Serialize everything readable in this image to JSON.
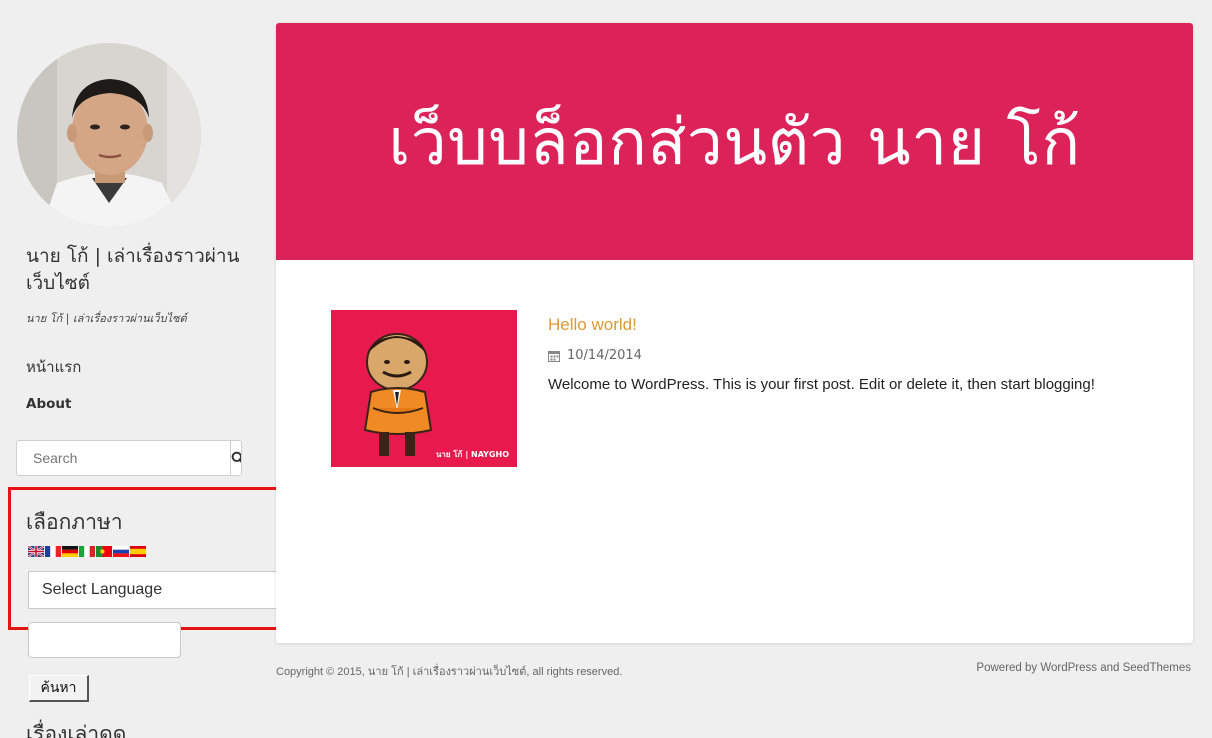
{
  "sidebar": {
    "site_title": "นาย โก้ | เล่าเรื่องราวผ่านเว็บไซต์",
    "site_tagline": "นาย โก้ | เล่าเรื่องราวผ่านเว็บไซต์",
    "nav": [
      {
        "label": "หน้าแรก"
      },
      {
        "label": "About"
      }
    ],
    "search": {
      "placeholder": "Search",
      "icon": "search-icon"
    },
    "language_widget": {
      "title": "เลือกภาษา",
      "flags": [
        "english",
        "french",
        "german",
        "italian",
        "portuguese",
        "russian",
        "spanish"
      ],
      "select_value": "Select Language"
    },
    "find_button": "ค้นหา",
    "next_heading": "เรื่องเล่าดูด"
  },
  "header": {
    "banner_title": "เว็บบล็อกส่วนตัว นาย โก้",
    "banner_color": "#dc2359"
  },
  "post": {
    "title": "Hello world!",
    "date": "10/14/2014",
    "excerpt": "Welcome to WordPress. This is your first post. Edit or delete it, then start blogging!",
    "thumbnail_watermark": "นาย โก้ | NAYGHO",
    "title_color": "#dd9933"
  },
  "footer": {
    "copyright": "Copyright © 2015, นาย โก้ | เล่าเรื่องราวผ่านเว็บไซต์, all rights reserved.",
    "powered": "Powered by WordPress and SeedThemes"
  }
}
